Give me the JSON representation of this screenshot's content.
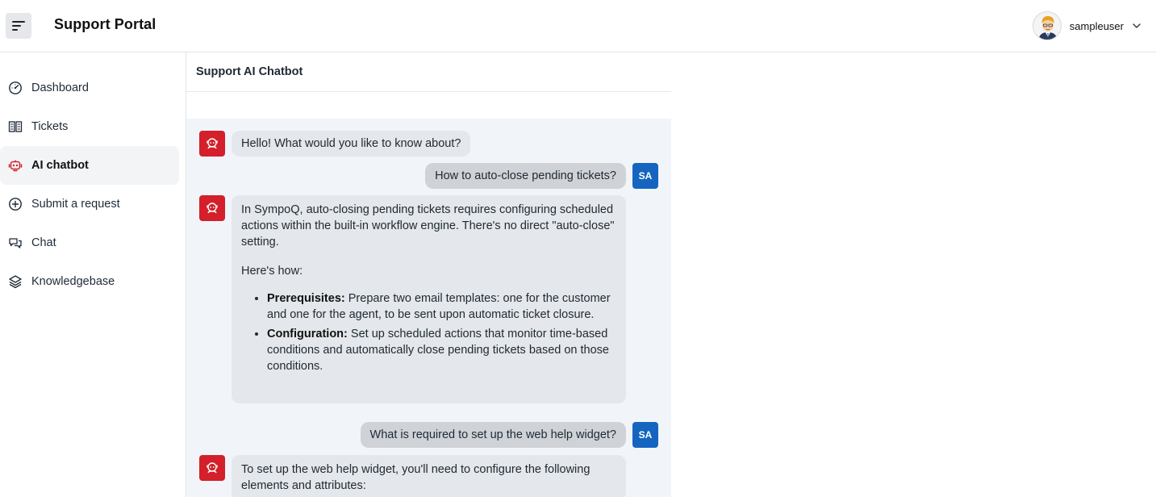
{
  "header": {
    "app_title": "Support Portal",
    "username": "sampleuser",
    "menu_icon": "menu-icon",
    "chevron_icon": "chevron-down-icon"
  },
  "sidebar": {
    "items": [
      {
        "label": "Dashboard",
        "icon": "dashboard-icon"
      },
      {
        "label": "Tickets",
        "icon": "tickets-icon"
      },
      {
        "label": "AI chatbot",
        "icon": "robot-icon"
      },
      {
        "label": "Submit a request",
        "icon": "plus-circle-icon"
      },
      {
        "label": "Chat",
        "icon": "chat-icon"
      },
      {
        "label": "Knowledgebase",
        "icon": "layers-icon"
      }
    ],
    "active_index": 2,
    "accent_color": "#d3202a"
  },
  "chat": {
    "title": "Support AI Chatbot",
    "user_initials": "SA",
    "messages": [
      {
        "from": "bot",
        "text": "Hello! What would you like to know about?"
      },
      {
        "from": "user",
        "text": "How to auto-close pending tickets?"
      },
      {
        "from": "bot",
        "intro": "In SympoQ, auto-closing pending tickets requires configuring scheduled actions within the built-in workflow engine. There's no direct \"auto-close\" setting.",
        "lead": "Here's how:",
        "bullets": [
          {
            "term": "Prerequisites:",
            "text": "Prepare two email templates: one for the customer and one for the agent, to be sent upon automatic ticket closure."
          },
          {
            "term": "Configuration:",
            "text": "Set up scheduled actions that monitor time-based conditions and automatically close pending tickets based on those conditions."
          }
        ]
      },
      {
        "from": "user",
        "text": "What is required to set up the web help widget?"
      },
      {
        "from": "bot",
        "text": "To set up the web help widget, you'll need to configure the following elements and attributes:"
      }
    ]
  },
  "colors": {
    "bot_avatar": "#d3202a",
    "user_badge": "#1565c0",
    "chat_background": "#f1f5f9"
  }
}
